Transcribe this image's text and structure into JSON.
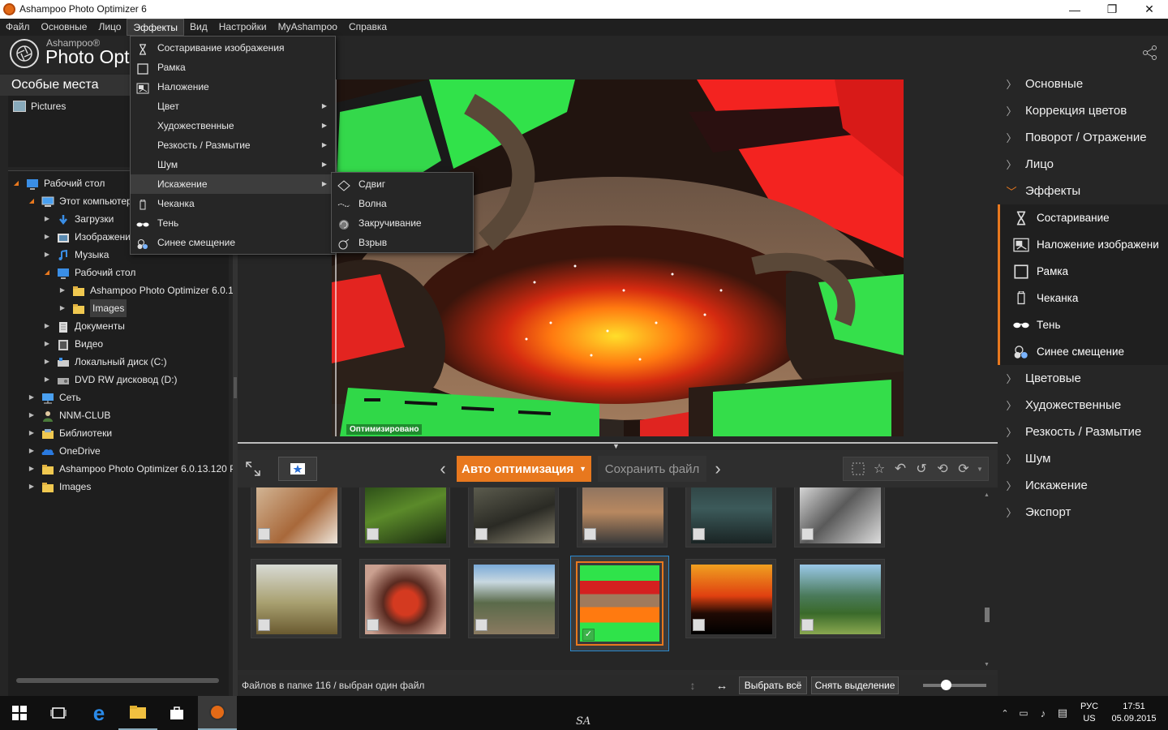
{
  "window": {
    "title": "Ashampoo Photo Optimizer 6",
    "minimize": "—",
    "maximize": "❐",
    "close": "✕"
  },
  "menubar": {
    "items": [
      "Файл",
      "Основные",
      "Лицо",
      "Эффекты",
      "Вид",
      "Настройки",
      "MyAshampoo",
      "Справка"
    ],
    "active": "Эффекты"
  },
  "brand": {
    "small": "Ashampoo®",
    "large": "Photo Opt"
  },
  "left": {
    "section_title": "Особые места",
    "places": [
      "Pictures"
    ],
    "tree": [
      {
        "label": "Рабочий стол",
        "level": 0,
        "state": "open",
        "icon": "desktop-icon"
      },
      {
        "label": "Этот компьютер",
        "level": 1,
        "state": "open",
        "icon": "computer-icon"
      },
      {
        "label": "Загрузки",
        "level": 2,
        "state": "closed",
        "icon": "downloads-icon"
      },
      {
        "label": "Изображения",
        "level": 2,
        "state": "closed",
        "icon": "pictures-folder-icon"
      },
      {
        "label": "Музыка",
        "level": 2,
        "state": "closed",
        "icon": "music-icon"
      },
      {
        "label": "Рабочий стол",
        "level": 2,
        "state": "open",
        "icon": "desktop-icon"
      },
      {
        "label": "Ashampoo Photo Optimizer 6.0.1",
        "level": 3,
        "state": "closed",
        "icon": "folder-icon"
      },
      {
        "label": "Images",
        "level": 3,
        "state": "closed",
        "icon": "folder-icon",
        "selected": true
      },
      {
        "label": "Документы",
        "level": 2,
        "state": "closed",
        "icon": "documents-icon"
      },
      {
        "label": "Видео",
        "level": 2,
        "state": "closed",
        "icon": "video-icon"
      },
      {
        "label": "Локальный диск (C:)",
        "level": 2,
        "state": "closed",
        "icon": "drive-icon"
      },
      {
        "label": "DVD RW дисковод (D:)",
        "level": 2,
        "state": "closed",
        "icon": "dvd-icon"
      },
      {
        "label": "Сеть",
        "level": 1,
        "state": "closed",
        "icon": "network-icon"
      },
      {
        "label": "NNM-CLUB",
        "level": 1,
        "state": "closed",
        "icon": "user-icon"
      },
      {
        "label": "Библиотеки",
        "level": 1,
        "state": "closed",
        "icon": "libraries-icon"
      },
      {
        "label": "OneDrive",
        "level": 1,
        "state": "closed",
        "icon": "onedrive-icon"
      },
      {
        "label": "Ashampoo Photo Optimizer 6.0.13.120 P",
        "level": 1,
        "state": "closed",
        "icon": "folder-icon"
      },
      {
        "label": "Images",
        "level": 1,
        "state": "closed",
        "icon": "folder-icon"
      }
    ]
  },
  "effects_menu": [
    {
      "label": "Состаривание изображения",
      "icon": "hourglass-icon"
    },
    {
      "label": "Рамка",
      "icon": "frame-icon"
    },
    {
      "label": "Наложение",
      "icon": "overlay-icon"
    },
    {
      "label": "Цвет",
      "submenu": true
    },
    {
      "label": "Художественные",
      "submenu": true
    },
    {
      "label": "Резкость / Размытие",
      "submenu": true
    },
    {
      "label": "Шум",
      "submenu": true
    },
    {
      "label": "Искажение",
      "submenu": true,
      "highlighted": true
    },
    {
      "label": "Чеканка",
      "icon": "emboss-icon"
    },
    {
      "label": "Тень",
      "icon": "sunglasses-icon"
    },
    {
      "label": "Синее смещение",
      "icon": "blueshift-icon"
    }
  ],
  "distortion_menu": [
    {
      "label": "Сдвиг",
      "icon": "shift-icon"
    },
    {
      "label": "Волна",
      "icon": "wave-icon"
    },
    {
      "label": "Закручивание",
      "icon": "twirl-icon"
    },
    {
      "label": "Взрыв",
      "icon": "explode-icon"
    }
  ],
  "viewer": {
    "label": "Оптимизировано"
  },
  "toolbar": {
    "auto": "Авто оптимизация",
    "save": "Сохранить файл"
  },
  "status": {
    "text": "Файлов в папке 116 / выбран один файл",
    "select_all": "Выбрать всё",
    "deselect": "Снять выделение"
  },
  "right": {
    "top_items": [
      "Основные",
      "Коррекция цветов",
      "Поворот / Отражение",
      "Лицо",
      "Эффекты"
    ],
    "sub_items": [
      {
        "label": "Состаривание",
        "icon": "hourglass-icon"
      },
      {
        "label": "Наложение изображени",
        "icon": "overlay-icon"
      },
      {
        "label": "Рамка",
        "icon": "frame-icon"
      },
      {
        "label": "Чеканка",
        "icon": "emboss-icon"
      },
      {
        "label": "Тень",
        "icon": "sunglasses-icon"
      },
      {
        "label": "Синее смещение",
        "icon": "blueshift-icon"
      }
    ],
    "bottom_items": [
      "Цветовые",
      "Художественные",
      "Резкость / Размытие",
      "Шум",
      "Искажение",
      "Экспорт"
    ]
  },
  "taskbar": {
    "lang": "РУС",
    "lang2": "US",
    "time": "17:51",
    "date": "05.09.2015",
    "watermark": "SA"
  },
  "colors": {
    "accent": "#e8781e",
    "panel": "#262626",
    "green": "#2fe34a",
    "red": "#f0201c"
  }
}
